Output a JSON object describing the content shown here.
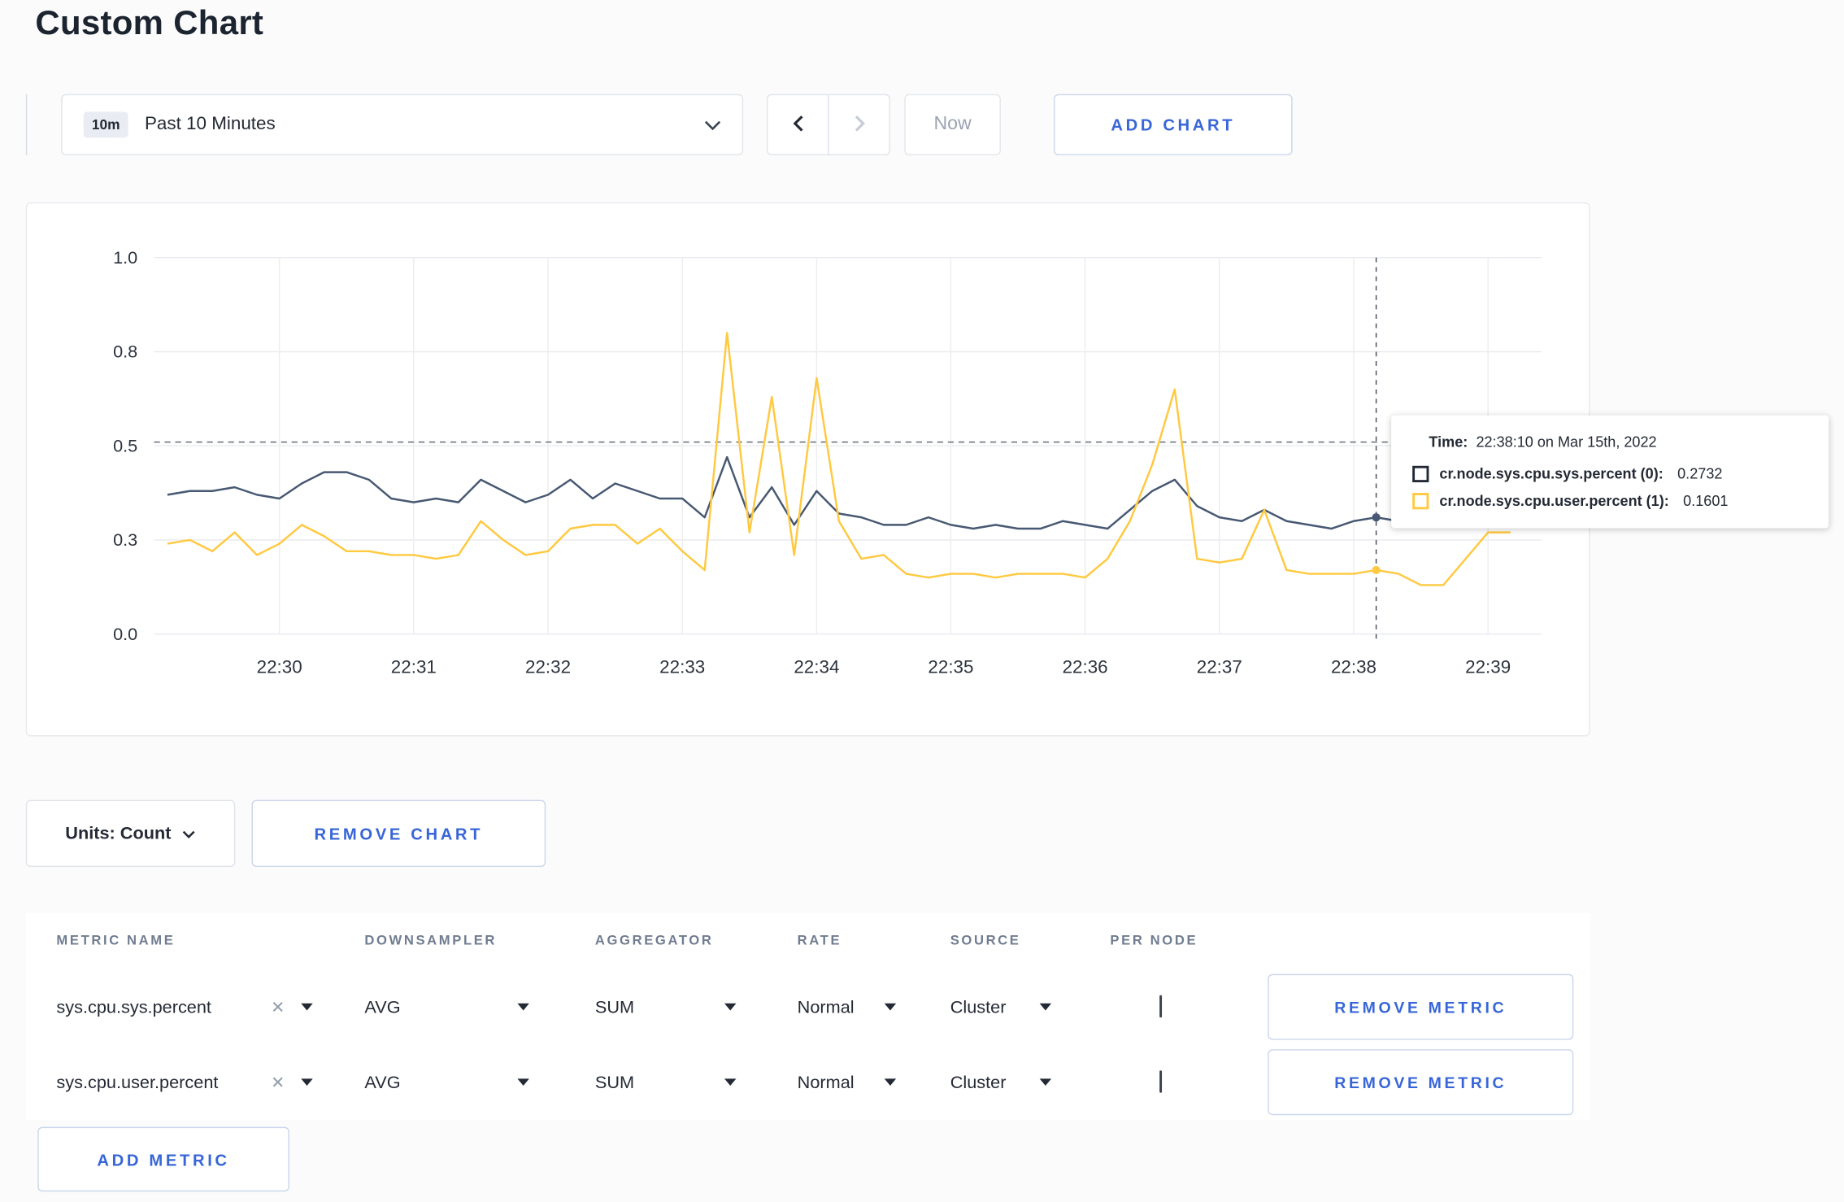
{
  "page": {
    "title": "Custom Chart"
  },
  "colors": {
    "accent_blue": "#3866d8",
    "line_sys": "#475872",
    "line_user": "#ffc940"
  },
  "toolbar": {
    "time_badge": "10m",
    "time_range": "Past 10 Minutes",
    "now_label": "Now",
    "add_chart_label": "ADD CHART"
  },
  "chart_controls": {
    "units_label": "Units: Count",
    "remove_chart_label": "REMOVE CHART"
  },
  "tooltip": {
    "time_label": "Time:",
    "time_value": "22:38:10 on Mar 15th, 2022",
    "series": [
      {
        "name": "cr.node.sys.cpu.sys.percent (0):",
        "value": "0.2732",
        "color": "#242a35"
      },
      {
        "name": "cr.node.sys.cpu.user.percent (1):",
        "value": "0.1601",
        "color": "#ffc940"
      }
    ]
  },
  "metrics_table": {
    "headers": [
      "METRIC NAME",
      "DOWNSAMPLER",
      "AGGREGATOR",
      "RATE",
      "SOURCE",
      "PER NODE"
    ],
    "rows": [
      {
        "metric": "sys.cpu.sys.percent",
        "downsampler": "AVG",
        "aggregator": "SUM",
        "rate": "Normal",
        "source": "Cluster",
        "per_node": false,
        "remove_label": "REMOVE METRIC"
      },
      {
        "metric": "sys.cpu.user.percent",
        "downsampler": "AVG",
        "aggregator": "SUM",
        "rate": "Normal",
        "source": "Cluster",
        "per_node": false,
        "remove_label": "REMOVE METRIC"
      }
    ],
    "add_metric_label": "ADD METRIC"
  },
  "chart_data": {
    "type": "line",
    "title": "",
    "xlabel": "",
    "ylabel": "",
    "ylim": [
      0,
      1
    ],
    "y_ticks": {
      "values": [
        0,
        0.25,
        0.5,
        0.75,
        1.0
      ],
      "labels": [
        "0.0",
        "0.3",
        "0.5",
        "0.8",
        "1.0"
      ]
    },
    "x_ticks": [
      "22:30",
      "22:31",
      "22:32",
      "22:33",
      "22:34",
      "22:35",
      "22:36",
      "22:37",
      "22:38",
      "22:39"
    ],
    "point_interval_sec": 10,
    "series": [
      {
        "name": "cr.node.sys.cpu.sys.percent",
        "color": "#475872",
        "values": [
          0.37,
          0.38,
          0.38,
          0.39,
          0.37,
          0.36,
          0.4,
          0.43,
          0.43,
          0.41,
          0.36,
          0.35,
          0.36,
          0.35,
          0.41,
          0.38,
          0.35,
          0.37,
          0.41,
          0.36,
          0.4,
          0.38,
          0.36,
          0.36,
          0.31,
          0.47,
          0.31,
          0.39,
          0.29,
          0.38,
          0.32,
          0.31,
          0.29,
          0.29,
          0.31,
          0.29,
          0.28,
          0.29,
          0.28,
          0.28,
          0.3,
          0.29,
          0.28,
          0.33,
          0.38,
          0.41,
          0.34,
          0.31,
          0.3,
          0.33,
          0.3,
          0.29,
          0.28,
          0.3,
          0.31,
          0.3,
          0.29,
          0.3,
          0.31,
          0.3,
          0.3
        ]
      },
      {
        "name": "cr.node.sys.cpu.user.percent",
        "color": "#ffc940",
        "values": [
          0.24,
          0.25,
          0.22,
          0.27,
          0.21,
          0.24,
          0.29,
          0.26,
          0.22,
          0.22,
          0.21,
          0.21,
          0.2,
          0.21,
          0.3,
          0.25,
          0.21,
          0.22,
          0.28,
          0.29,
          0.29,
          0.24,
          0.28,
          0.22,
          0.17,
          0.8,
          0.27,
          0.63,
          0.21,
          0.68,
          0.3,
          0.2,
          0.21,
          0.16,
          0.15,
          0.16,
          0.16,
          0.15,
          0.16,
          0.16,
          0.16,
          0.15,
          0.2,
          0.3,
          0.45,
          0.65,
          0.2,
          0.19,
          0.2,
          0.33,
          0.17,
          0.16,
          0.16,
          0.16,
          0.17,
          0.16,
          0.13,
          0.13,
          0.2,
          0.27,
          0.27
        ]
      }
    ],
    "crosshair": {
      "time": "22:38:10",
      "index": 54,
      "hline_value": 0.51
    },
    "grid": true,
    "legend_position": "tooltip"
  }
}
